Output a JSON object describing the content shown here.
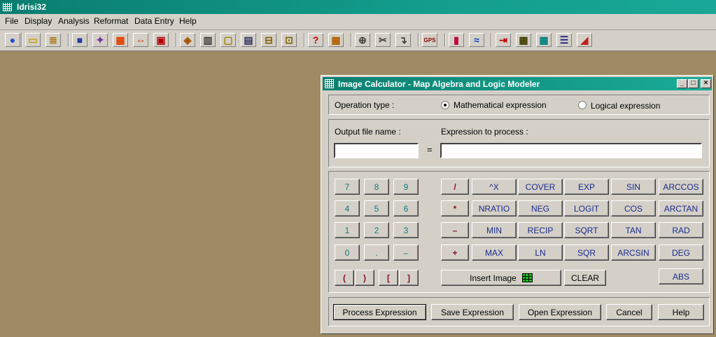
{
  "app": {
    "title": "Idrisi32"
  },
  "menu": [
    "File",
    "Display",
    "Analysis",
    "Reformat",
    "Data Entry",
    "Help"
  ],
  "toolbar": {
    "buttons": [
      {
        "name": "globe-icon",
        "glyph": "●",
        "color": "#1a4fd0"
      },
      {
        "name": "open-folder-icon",
        "glyph": "▭",
        "color": "#c8a000"
      },
      {
        "name": "list-icon",
        "glyph": "≣",
        "color": "#a07000"
      },
      {
        "name": "map-icon",
        "glyph": "■",
        "color": "#2040a0"
      },
      {
        "name": "points-icon",
        "glyph": "✦",
        "color": "#7030a0"
      },
      {
        "name": "palette-icon",
        "glyph": "▦",
        "color": "#e04000"
      },
      {
        "name": "arrows-icon",
        "glyph": "⇔",
        "color": "#d02000"
      },
      {
        "name": "layers-icon",
        "glyph": "▣",
        "color": "#b00000"
      },
      {
        "name": "composite-icon",
        "glyph": "◈",
        "color": "#a05000"
      },
      {
        "name": "image-icon",
        "glyph": "▥",
        "color": "#404040"
      },
      {
        "name": "frame-icon",
        "glyph": "▢",
        "color": "#a08000"
      },
      {
        "name": "grid-image-icon",
        "glyph": "▤",
        "color": "#303060"
      },
      {
        "name": "window-icon",
        "glyph": "⊟",
        "color": "#806000"
      },
      {
        "name": "compare-icon",
        "glyph": "⊡",
        "color": "#806000"
      },
      {
        "name": "query-icon",
        "glyph": "?",
        "color": "#c00000"
      },
      {
        "name": "table-icon",
        "glyph": "▦",
        "color": "#b06000"
      },
      {
        "name": "crosshair-icon",
        "glyph": "⊕",
        "color": "#404040"
      },
      {
        "name": "scissors-icon",
        "glyph": "✂",
        "color": "#404040"
      },
      {
        "name": "arrow-down-icon",
        "glyph": "↴",
        "color": "#404040"
      },
      {
        "name": "gps-icon",
        "glyph": "GPS",
        "color": "#8b0000"
      },
      {
        "name": "histogram-icon",
        "glyph": "▮",
        "color": "#c00040"
      },
      {
        "name": "wave-icon",
        "glyph": "≈",
        "color": "#1040c0"
      },
      {
        "name": "import-icon",
        "glyph": "⇥",
        "color": "#c00000"
      },
      {
        "name": "database-icon",
        "glyph": "▦",
        "color": "#404000"
      },
      {
        "name": "spreadsheet-icon",
        "glyph": "▦",
        "color": "#008080"
      },
      {
        "name": "legend-icon",
        "glyph": "☰",
        "color": "#202080"
      },
      {
        "name": "eraser-icon",
        "glyph": "◢",
        "color": "#c02020"
      }
    ]
  },
  "dialog": {
    "title": "Image Calculator - Map  Algebra and Logic Modeler",
    "window_buttons": [
      "_",
      "□",
      "×"
    ],
    "operation_label": "Operation type :",
    "radio_math": "Mathematical expression",
    "radio_logic": "Logical expression",
    "output_label": "Output file name :",
    "expression_label": "Expression to process :",
    "output_value": "",
    "expression_value": "",
    "equals": "=",
    "keys": {
      "numbers": [
        "7",
        "8",
        "9",
        "4",
        "5",
        "6",
        "1",
        "2",
        "3",
        "0",
        ".",
        "–"
      ],
      "brackets": [
        "(",
        ")",
        "[",
        "]"
      ],
      "operators": [
        "/",
        "*",
        "–",
        "+"
      ],
      "col2": [
        "^X",
        "NRATIO",
        "MIN",
        "MAX"
      ],
      "col3": [
        "COVER",
        "NEG",
        "RECIP",
        "LN"
      ],
      "col4": [
        "EXP",
        "LOGIT",
        "SQRT",
        "SQR"
      ],
      "col5": [
        "SIN",
        "COS",
        "TAN",
        "ARCSIN"
      ],
      "col6": [
        "ARCCOS",
        "ARCTAN",
        "RAD",
        "DEG",
        "ABS"
      ],
      "insert_image": "Insert Image",
      "clear": "CLEAR"
    },
    "actions": [
      "Process Expression",
      "Save Expression",
      "Open Expression",
      "Cancel",
      "Help"
    ]
  }
}
